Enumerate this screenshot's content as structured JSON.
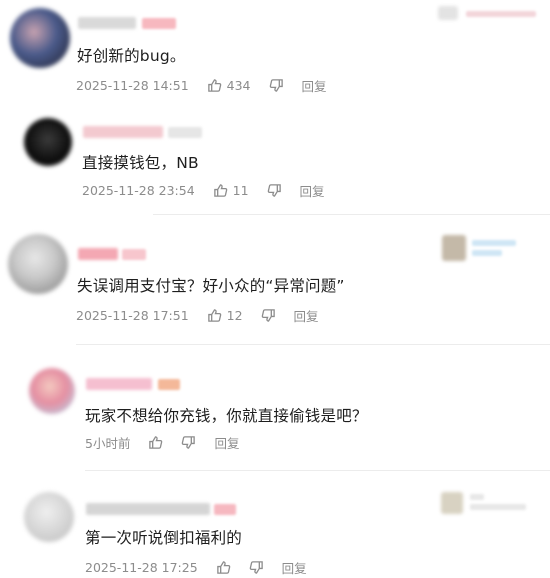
{
  "comments": [
    {
      "text": "好创新的bug。",
      "time": "2025-11-28 14:51",
      "likes": "434",
      "reply_label": "回复",
      "avatar_colors": [
        "#4a5a8a",
        "#c7a2b0",
        "#2f3550"
      ],
      "name_color": "#d9d9d9",
      "tag_color": "#f7b8bf"
    },
    {
      "text": "直接摸钱包，NB",
      "time": "2025-11-28 23:54",
      "likes": "11",
      "reply_label": "回复",
      "avatar_colors": [
        "#111111",
        "#3a3a3a",
        "#000000"
      ],
      "name_color": "#f3c9cf",
      "tag_color": "#e6e6e6"
    },
    {
      "text": "失误调用支付宝？好小众的“异常问题”",
      "time": "2025-11-28 17:51",
      "likes": "12",
      "reply_label": "回复",
      "avatar_colors": [
        "#c9c9c9",
        "#8b8b8b",
        "#e7e7e7"
      ],
      "name_color": "#f4a8b3",
      "tag_color": "#f7c6cd",
      "badge_colors": [
        "#c4b9a8",
        "#cfe6f5"
      ]
    },
    {
      "text": "玩家不想给你充钱，你就直接偷钱是吧？",
      "time": "5小时前",
      "likes": "",
      "reply_label": "回复",
      "avatar_colors": [
        "#e58fa2",
        "#b6d3ea",
        "#f4c9c0"
      ],
      "name_color": "#f5bfd0",
      "tag_color": "#f4b899"
    },
    {
      "text": "第一次听说倒扣福利的",
      "time": "2025-11-28 17:25",
      "likes": "",
      "reply_label": "回复",
      "avatar_colors": [
        "#d6d6d6",
        "#bdbdbd",
        "#efefef"
      ],
      "name_color": "#d5d5d5",
      "tag_color": "#f6b8c0",
      "badge_colors": [
        "#d8d2c2",
        "#e7e7e7"
      ]
    }
  ],
  "icons": {
    "like": "thumbs-up-icon",
    "dislike": "thumbs-down-icon"
  }
}
